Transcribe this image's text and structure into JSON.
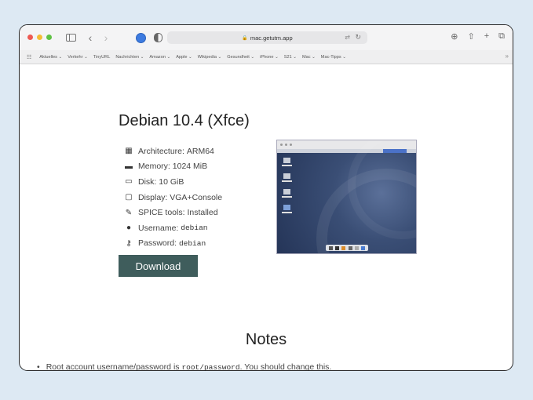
{
  "browser": {
    "address": "mac.getutm.app",
    "bookmarks": [
      "Aktuelles ⌄",
      "Verkehr ⌄",
      "TinyURL",
      "Nachrichten ⌄",
      "Amazon ⌄",
      "Apple ⌄",
      "Wikipedia ⌄",
      "Gesundheit ⌄",
      "iPhone ⌄",
      "S21 ⌄",
      "Mac ⌄",
      "Mac-Tipps ⌄"
    ]
  },
  "page": {
    "title": "Debian 10.4 (Xfce)",
    "specs": [
      {
        "icon": "chip-icon",
        "glyph": "▦",
        "label": "Architecture: ",
        "value": "ARM64",
        "mono": false
      },
      {
        "icon": "memory-icon",
        "glyph": "▬",
        "label": "Memory: ",
        "value": "1024 MiB",
        "mono": false
      },
      {
        "icon": "disk-icon",
        "glyph": "▭",
        "label": "Disk: ",
        "value": "10 GiB",
        "mono": false
      },
      {
        "icon": "display-icon",
        "glyph": "▢",
        "label": "Display: ",
        "value": "VGA+Console",
        "mono": false
      },
      {
        "icon": "wrench-icon",
        "glyph": "✎",
        "label": "SPICE tools: ",
        "value": "Installed",
        "mono": false
      },
      {
        "icon": "user-icon",
        "glyph": "●",
        "label": "Username: ",
        "value": "debian",
        "mono": true
      },
      {
        "icon": "key-icon",
        "glyph": "⚷",
        "label": "Password: ",
        "value": "debian",
        "mono": true
      }
    ],
    "download_label": "Download",
    "notes_heading": "Notes",
    "note": {
      "prefix": "Root account username/password is ",
      "code": "root/password",
      "suffix": ". You should change this."
    }
  }
}
